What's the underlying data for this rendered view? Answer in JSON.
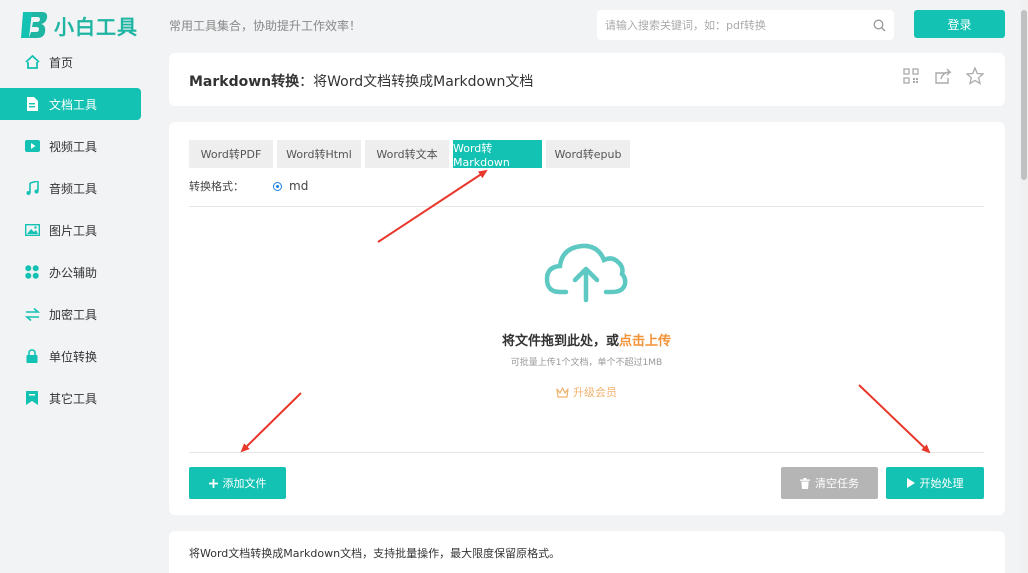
{
  "brand": {
    "name": "小白工具",
    "slogan": "常用工具集合，协助提升工作效率！",
    "accent": "#13c2b3"
  },
  "search": {
    "placeholder": "请输入搜索关键词，如：pdf转换"
  },
  "header": {
    "login_label": "登录"
  },
  "sidebar": {
    "items": [
      {
        "label": "首页",
        "icon": "home-icon"
      },
      {
        "label": "文档工具",
        "icon": "document-icon",
        "active": true
      },
      {
        "label": "视频工具",
        "icon": "video-icon"
      },
      {
        "label": "音频工具",
        "icon": "music-icon"
      },
      {
        "label": "图片工具",
        "icon": "image-icon"
      },
      {
        "label": "办公辅助",
        "icon": "grid-icon"
      },
      {
        "label": "加密工具",
        "icon": "swap-icon"
      },
      {
        "label": "单位转换",
        "icon": "lock-icon"
      },
      {
        "label": "其它工具",
        "icon": "bookmark-icon"
      }
    ]
  },
  "page": {
    "title_bold": "Markdown转换",
    "title_rest": "：将Word文档转换成Markdown文档",
    "actions": [
      "qrcode-icon",
      "share-icon",
      "star-icon"
    ]
  },
  "tabs": [
    {
      "label": "Word转PDF"
    },
    {
      "label": "Word转Html"
    },
    {
      "label": "Word转文本"
    },
    {
      "label": "Word转Markdown",
      "active": true
    },
    {
      "label": "Word转epub"
    }
  ],
  "format": {
    "label": "转换格式：",
    "selected": "md"
  },
  "upload": {
    "title_prefix": "将文件拖到此处，或",
    "title_link": "点击上传",
    "subtitle": "可批量上传1个文档，单个不超过1MB",
    "upgrade_label": "升级会员"
  },
  "buttons": {
    "add": "添加文件",
    "clear": "清空任务",
    "start": "开始处理"
  },
  "description": "将Word文档转换成Markdown文档，支持批量操作，最大限度保留原格式。",
  "colors": {
    "accent": "#13c2b3",
    "link": "#f39237",
    "disabled": "#b5b5b5",
    "annotation_arrow": "#e8372b"
  }
}
